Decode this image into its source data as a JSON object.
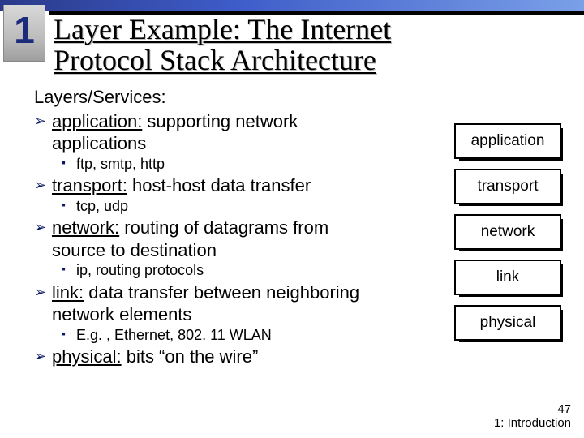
{
  "chapter": "1",
  "title_line1": "Layer Example:  The Internet",
  "title_line2": "Protocol Stack Architecture",
  "heading": "Layers/Services:",
  "items": [
    {
      "term": "application:",
      "desc": " supporting network applications",
      "sub": "ftp, smtp, http"
    },
    {
      "term": "transport:",
      "desc": " host-host data transfer",
      "sub": "tcp, udp"
    },
    {
      "term": "network:",
      "desc": " routing of datagrams from source to destination",
      "sub": "ip, routing protocols"
    },
    {
      "term": "link:",
      "desc": " data transfer between neighboring network elements",
      "sub": "E.g. , Ethernet, 802. 11 WLAN"
    },
    {
      "term": "physical:",
      "desc": " bits “on the wire”",
      "sub": null
    }
  ],
  "stack": [
    "application",
    "transport",
    "network",
    "link",
    "physical"
  ],
  "footer_num": "47",
  "footer_text": "1: Introduction"
}
